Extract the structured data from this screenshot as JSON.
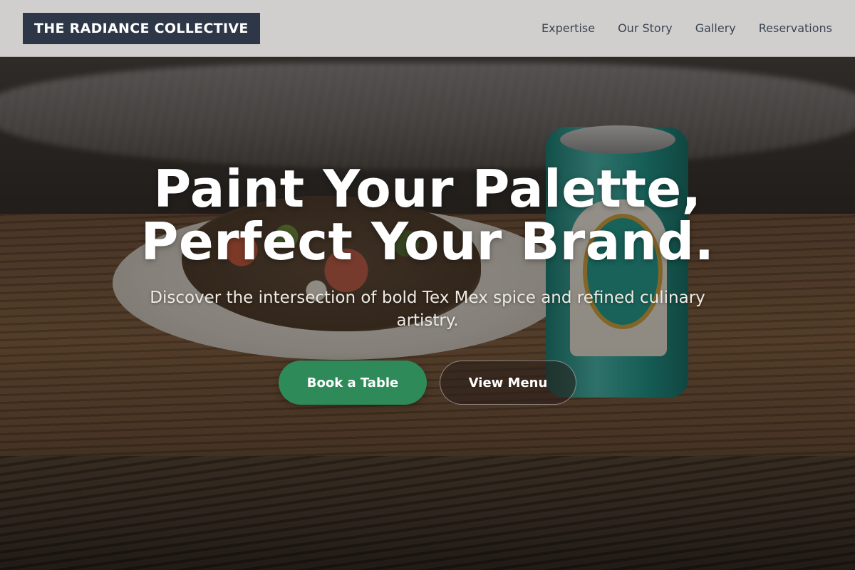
{
  "header": {
    "brand": "THE RADIANCE COLLECTIVE",
    "nav": [
      {
        "label": "Expertise"
      },
      {
        "label": "Our Story"
      },
      {
        "label": "Gallery"
      },
      {
        "label": "Reservations"
      }
    ]
  },
  "hero": {
    "headline_line1": "Paint Your Palette,",
    "headline_line2": "Perfect Your Brand.",
    "subtitle": "Discover the intersection of bold Tex Mex spice and refined culinary artistry.",
    "primary_cta": "Book a Table",
    "secondary_cta": "View Menu",
    "background_image": "photo-taco-plate-and-teal-beer-can-on-wooden-table"
  },
  "colors": {
    "brand_bg": "#2d3748",
    "primary_button": "#2f8a5a",
    "header_bg": "#dedcda",
    "nav_text": "#3a4453"
  }
}
